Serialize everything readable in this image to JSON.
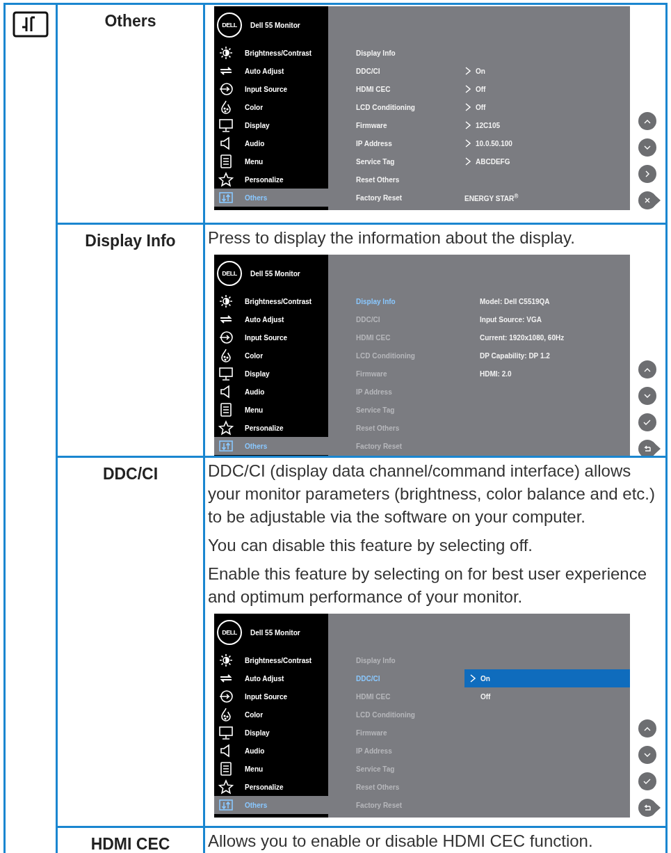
{
  "rows": [
    {
      "name": "Others",
      "paragraphs": [],
      "osd": {
        "logo": "DELL",
        "title": "Dell 55 Monitor",
        "menu": [
          {
            "label": "Brightness/Contrast",
            "selected": false
          },
          {
            "label": "Auto Adjust",
            "selected": false
          },
          {
            "label": "Input Source",
            "selected": false
          },
          {
            "label": "Color",
            "selected": false
          },
          {
            "label": "Display",
            "selected": false
          },
          {
            "label": "Audio",
            "selected": false
          },
          {
            "label": "Menu",
            "selected": false
          },
          {
            "label": "Personalize",
            "selected": false
          },
          {
            "label": "Others",
            "selected": true
          }
        ],
        "items": [
          {
            "label": "Display Info",
            "selected": false,
            "dimmed": false
          },
          {
            "label": "DDC/CI",
            "value": "On",
            "arrow": true,
            "selected": false,
            "dimmed": false
          },
          {
            "label": "HDMI CEC",
            "value": "Off",
            "arrow": true,
            "selected": false,
            "dimmed": false
          },
          {
            "label": "LCD Conditioning",
            "value": "Off",
            "arrow": true,
            "selected": false,
            "dimmed": false
          },
          {
            "label": "Firmware",
            "value": "12C105",
            "arrow": true,
            "selected": false,
            "dimmed": false
          },
          {
            "label": "IP Address",
            "value": "10.0.50.100",
            "arrow": true,
            "selected": false,
            "dimmed": false
          },
          {
            "label": "Service Tag",
            "value": "ABCDEFG",
            "arrow": true,
            "selected": false,
            "dimmed": false
          },
          {
            "label": "Reset Others",
            "selected": false,
            "dimmed": false
          },
          {
            "label": "Factory Reset",
            "value": "ENERGY STAR$^{®}$",
            "arrow": false,
            "selected": false,
            "dimmed": false
          }
        ],
        "buttons": [
          {
            "kind": "up"
          },
          {
            "kind": "down"
          },
          {
            "kind": "right"
          },
          {
            "kind": "close"
          }
        ]
      }
    },
    {
      "name": "Display Info",
      "paragraphs": [
        "Press to display the information about the display."
      ],
      "osd": {
        "logo": "DELL",
        "title": "Dell 55 Monitor",
        "menu": [
          {
            "label": "Brightness/Contrast",
            "selected": false
          },
          {
            "label": "Auto Adjust",
            "selected": false
          },
          {
            "label": "Input Source",
            "selected": false
          },
          {
            "label": "Color",
            "selected": false
          },
          {
            "label": "Display",
            "selected": false
          },
          {
            "label": "Audio",
            "selected": false
          },
          {
            "label": "Menu",
            "selected": false
          },
          {
            "label": "Personalize",
            "selected": false
          },
          {
            "label": "Others",
            "selected": true
          }
        ],
        "items": [
          {
            "label": "Display Info",
            "selected": true,
            "dimmed": false
          },
          {
            "label": "DDC/CI",
            "selected": false,
            "dimmed": true
          },
          {
            "label": "HDMI CEC",
            "selected": false,
            "dimmed": true
          },
          {
            "label": "LCD Conditioning",
            "selected": false,
            "dimmed": true
          },
          {
            "label": "Firmware",
            "selected": false,
            "dimmed": true
          },
          {
            "label": "IP Address",
            "selected": false,
            "dimmed": true
          },
          {
            "label": "Service Tag",
            "selected": false,
            "dimmed": true
          },
          {
            "label": "Reset Others",
            "selected": false,
            "dimmed": true
          },
          {
            "label": "Factory Reset",
            "selected": false,
            "dimmed": true
          }
        ],
        "info": [
          "Model: Dell C5519QA",
          "Input Source: VGA",
          "Current: 1920x1080, 60Hz",
          "DP Capability: DP 1.2",
          "HDMI: 2.0"
        ],
        "buttons": [
          {
            "kind": "up"
          },
          {
            "kind": "down"
          },
          {
            "kind": "check"
          },
          {
            "kind": "back"
          }
        ]
      }
    },
    {
      "name": "DDC/CI",
      "paragraphs": [
        "DDC/CI (display data channel/command interface) allows your monitor parameters (brightness, color balance and etc.) to be adjustable via the software on your computer.",
        "You can disable this feature by selecting off.",
        "Enable this feature by selecting on for best user experience and optimum performance of your monitor."
      ],
      "osd": {
        "logo": "DELL",
        "title": "Dell 55 Monitor",
        "menu": [
          {
            "label": "Brightness/Contrast",
            "selected": false
          },
          {
            "label": "Auto Adjust",
            "selected": false
          },
          {
            "label": "Input Source",
            "selected": false
          },
          {
            "label": "Color",
            "selected": false
          },
          {
            "label": "Display",
            "selected": false
          },
          {
            "label": "Audio",
            "selected": false
          },
          {
            "label": "Menu",
            "selected": false
          },
          {
            "label": "Personalize",
            "selected": false
          },
          {
            "label": "Others",
            "selected": true
          }
        ],
        "items": [
          {
            "label": "Display Info",
            "selected": false,
            "dimmed": true
          },
          {
            "label": "DDC/CI",
            "selected": true,
            "dimmed": false
          },
          {
            "label": "HDMI CEC",
            "selected": false,
            "dimmed": true
          },
          {
            "label": "LCD Conditioning",
            "selected": false,
            "dimmed": true
          },
          {
            "label": "Firmware",
            "selected": false,
            "dimmed": true
          },
          {
            "label": "IP Address",
            "selected": false,
            "dimmed": true
          },
          {
            "label": "Service Tag",
            "selected": false,
            "dimmed": true
          },
          {
            "label": "Reset Others",
            "selected": false,
            "dimmed": true
          },
          {
            "label": "Factory Reset",
            "selected": false,
            "dimmed": true
          }
        ],
        "options": [
          {
            "label": "On",
            "selected": true
          },
          {
            "label": "Off",
            "selected": false
          }
        ],
        "buttons": [
          {
            "kind": "up"
          },
          {
            "kind": "down"
          },
          {
            "kind": "check"
          },
          {
            "kind": "back"
          }
        ]
      }
    },
    {
      "name": "HDMI CEC",
      "paragraphs": [
        "Allows you to enable or disable HDMI CEC function."
      ]
    }
  ]
}
